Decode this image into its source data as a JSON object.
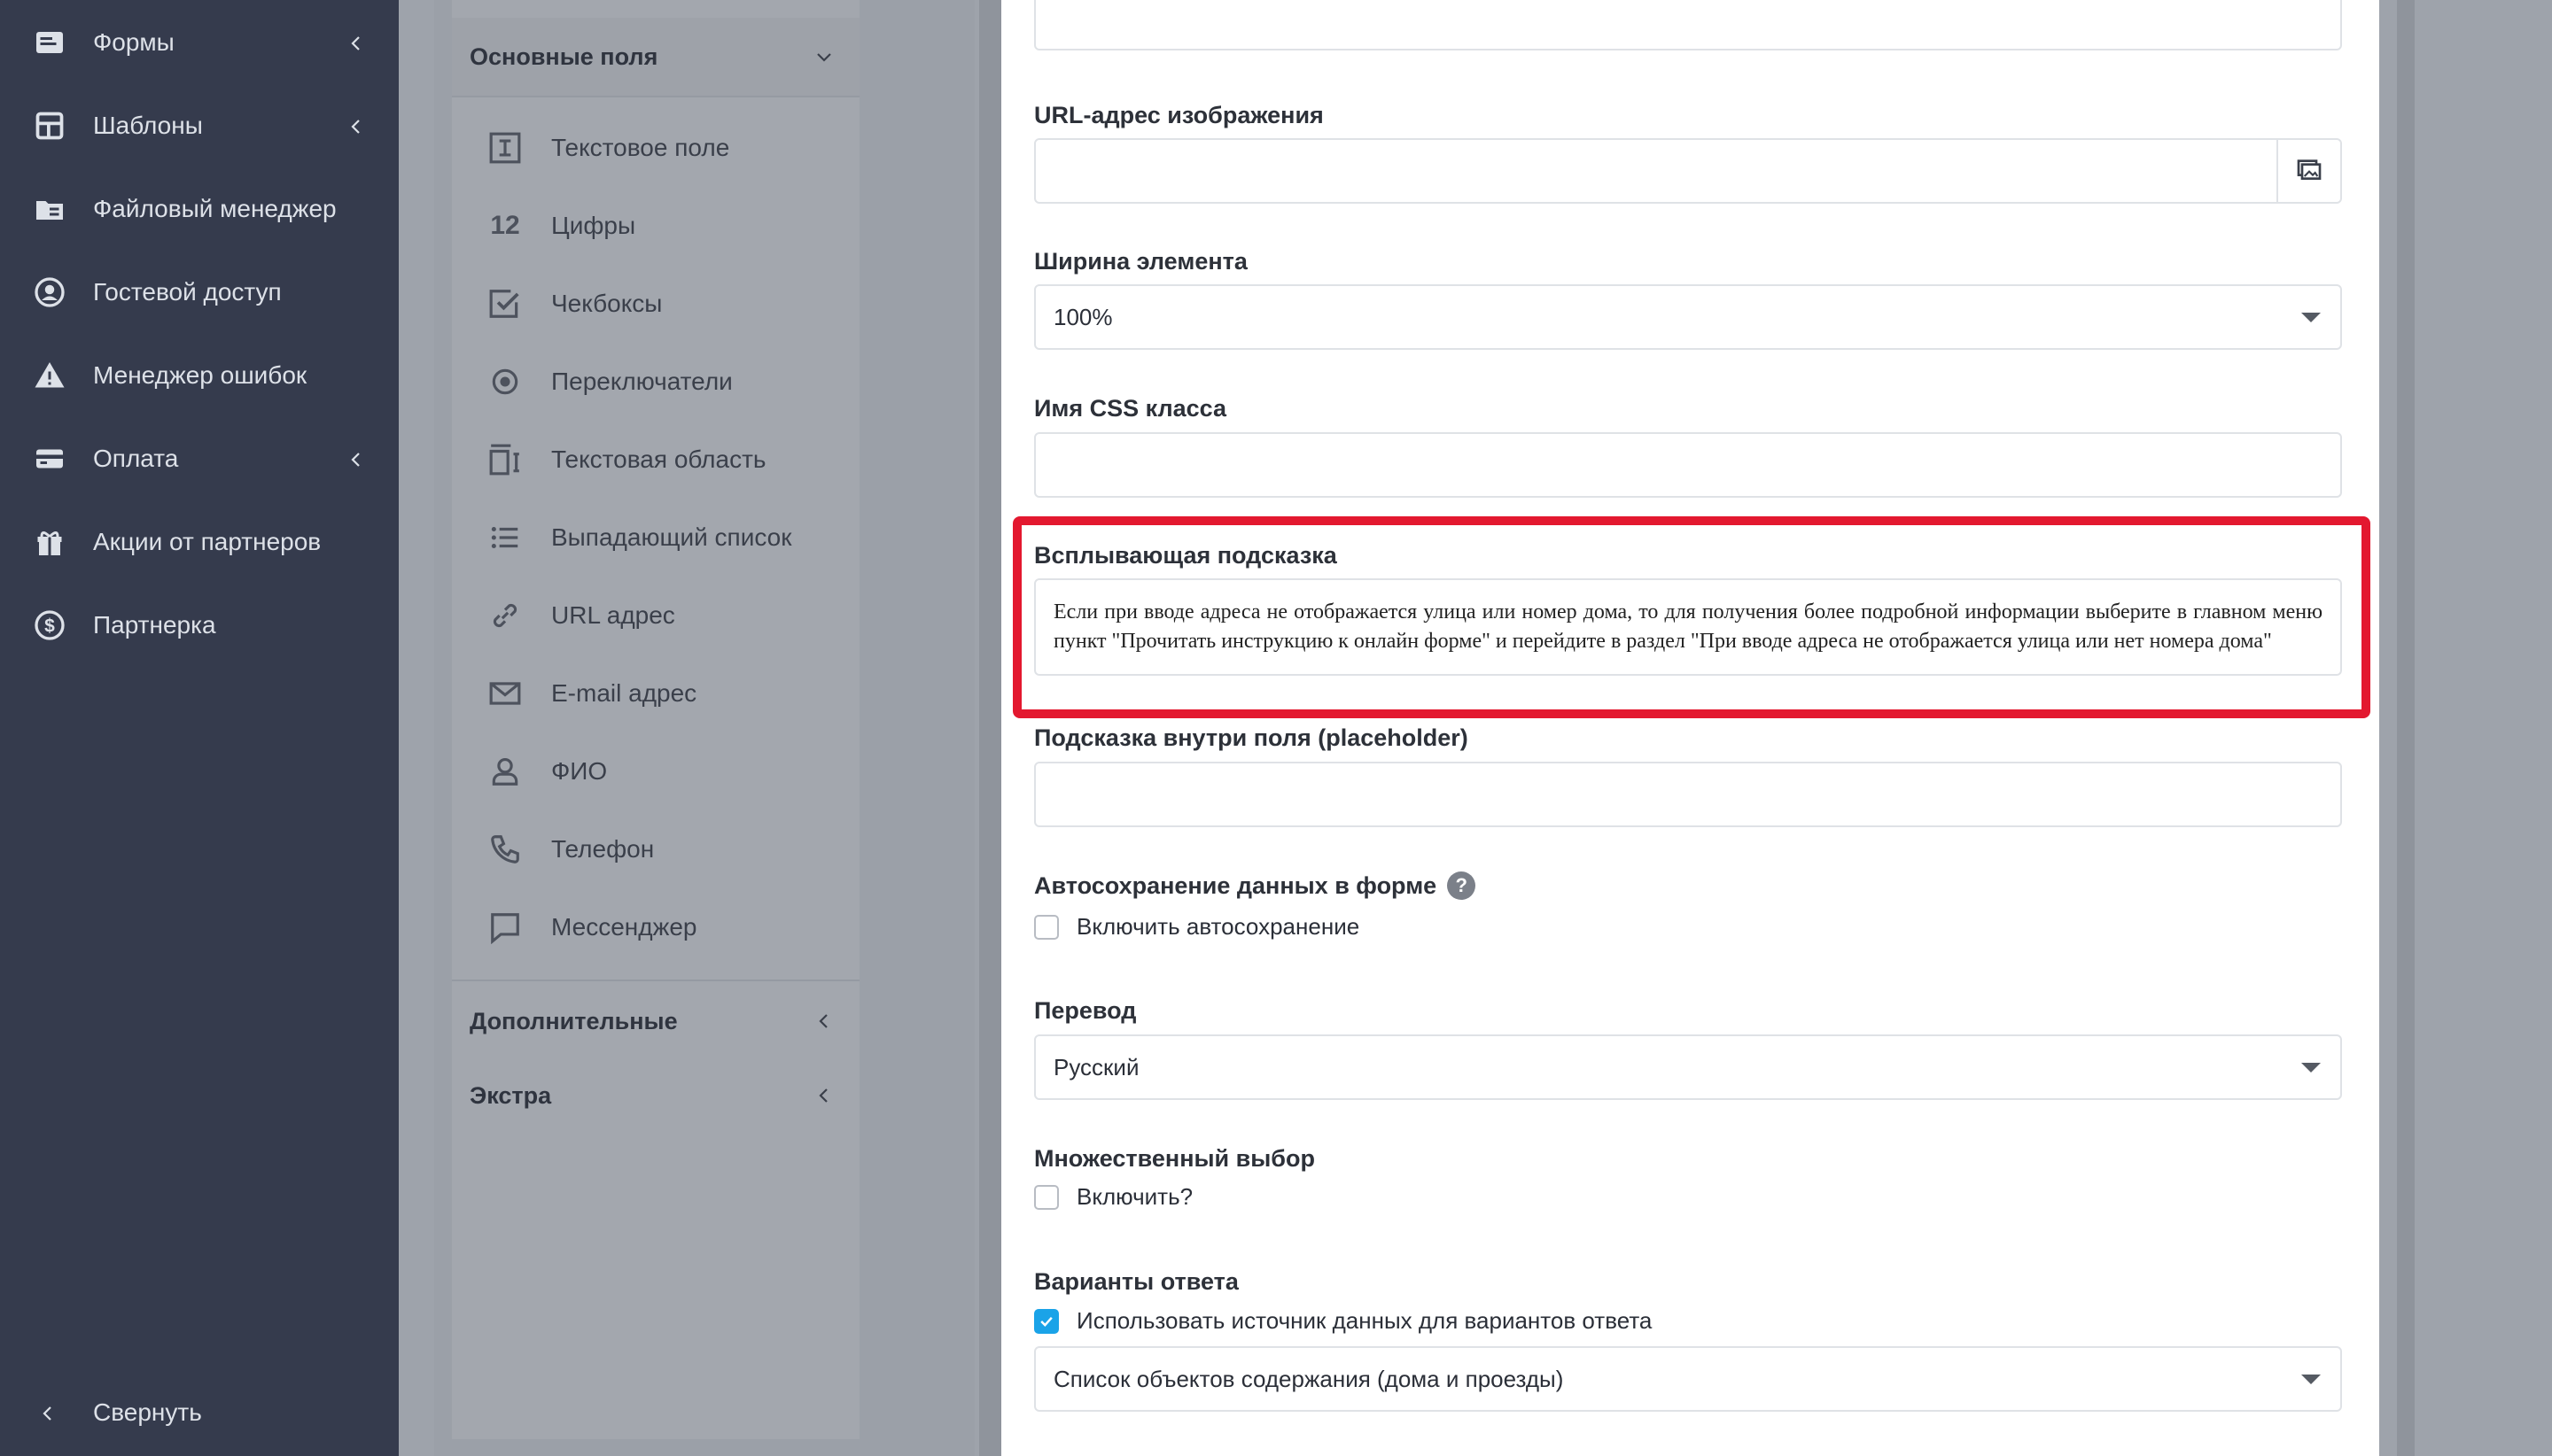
{
  "sidebar": {
    "items": [
      {
        "label": "Формы",
        "icon": "forms-icon",
        "has_children": true
      },
      {
        "label": "Шаблоны",
        "icon": "templates-icon",
        "has_children": true
      },
      {
        "label": "Файловый менеджер",
        "icon": "file-manager-icon",
        "has_children": false
      },
      {
        "label": "Гостевой доступ",
        "icon": "guest-user-icon",
        "has_children": false
      },
      {
        "label": "Менеджер ошибок",
        "icon": "warning-icon",
        "has_children": false
      },
      {
        "label": "Оплата",
        "icon": "credit-card-icon",
        "has_children": true
      },
      {
        "label": "Акции от партнеров",
        "icon": "gift-icon",
        "has_children": false
      },
      {
        "label": "Партнерка",
        "icon": "dollar-icon",
        "has_children": false
      }
    ],
    "collapse_label": "Свернуть"
  },
  "builder": {
    "main_group": "Основные поля",
    "fields": [
      {
        "label": "Текстовое поле",
        "icon": "text-field-icon"
      },
      {
        "label": "Цифры",
        "icon": "numbers-icon",
        "glyph": "12"
      },
      {
        "label": "Чекбоксы",
        "icon": "checkbox-icon"
      },
      {
        "label": "Переключатели",
        "icon": "radio-icon"
      },
      {
        "label": "Текстовая область",
        "icon": "textarea-icon"
      },
      {
        "label": "Выпадающий список",
        "icon": "list-icon"
      },
      {
        "label": "URL адрес",
        "icon": "link-icon"
      },
      {
        "label": "E-mail адрес",
        "icon": "mail-icon"
      },
      {
        "label": "ФИО",
        "icon": "user-icon"
      },
      {
        "label": "Телефон",
        "icon": "phone-icon"
      },
      {
        "label": "Мессенджер",
        "icon": "chat-icon"
      }
    ],
    "extra_groups": [
      "Дополнительные",
      "Экстра"
    ]
  },
  "settings": {
    "image_url": {
      "label": "URL-адрес изображения",
      "value": ""
    },
    "width": {
      "label": "Ширина элемента",
      "value": "100%"
    },
    "css_class": {
      "label": "Имя CSS класса",
      "value": ""
    },
    "tooltip": {
      "label": "Всплывающая подсказка",
      "value": "Если при вводе адреса не отображается улица или номер дома, то для получения более подробной информации выберите в главном меню пункт \"Прочитать инструкцию к онлайн форме\" и перейдите в раздел \"При вводе адреса не отображается улица или нет номера дома\""
    },
    "placeholder": {
      "label": "Подсказка внутри поля (placeholder)",
      "value": ""
    },
    "autosave": {
      "label": "Автосохранение данных в форме",
      "help": "?",
      "checkbox_label": "Включить автосохранение",
      "checked": false
    },
    "translation": {
      "label": "Перевод",
      "value": "Русский"
    },
    "multiple": {
      "label": "Множественный выбор",
      "checkbox_label": "Включить?",
      "checked": false
    },
    "options": {
      "label": "Варианты ответа",
      "checkbox_label": "Использовать источник данных для вариантов ответа",
      "checked": true,
      "source": "Список объектов содержания (дома и проезды)"
    }
  },
  "colors": {
    "sidebar_bg": "#353b4d",
    "highlight": "#e3182f",
    "check_accent": "#1aa3e8"
  }
}
